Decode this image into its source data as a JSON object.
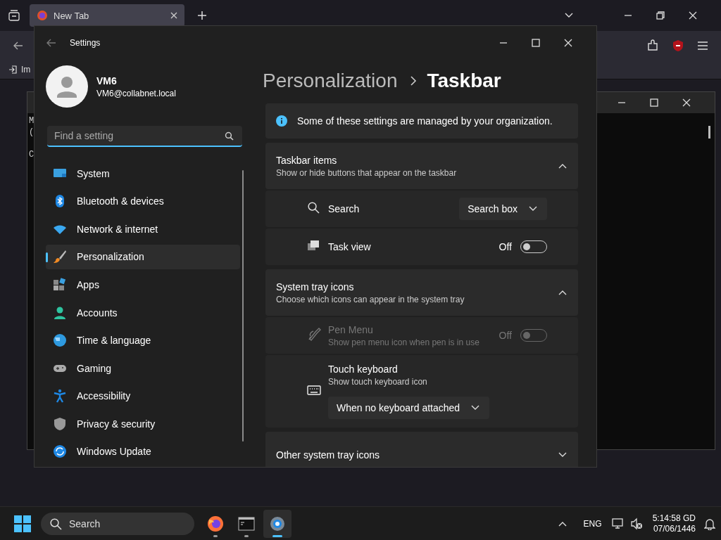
{
  "browser": {
    "tabs": [
      {
        "label": "New Tab",
        "selected": true
      }
    ],
    "bookmarks": [
      {
        "label": "Im"
      }
    ]
  },
  "terminal": {
    "lines": [
      "M",
      "(",
      "C"
    ]
  },
  "settings": {
    "title": "Settings",
    "user": {
      "name": "VM6",
      "email": "VM6@collabnet.local"
    },
    "search": {
      "placeholder": "Find a setting"
    },
    "nav": [
      {
        "label": "System",
        "selected": false
      },
      {
        "label": "Bluetooth & devices",
        "selected": false
      },
      {
        "label": "Network & internet",
        "selected": false
      },
      {
        "label": "Personalization",
        "selected": true
      },
      {
        "label": "Apps",
        "selected": false
      },
      {
        "label": "Accounts",
        "selected": false
      },
      {
        "label": "Time & language",
        "selected": false
      },
      {
        "label": "Gaming",
        "selected": false
      },
      {
        "label": "Accessibility",
        "selected": false
      },
      {
        "label": "Privacy & security",
        "selected": false
      },
      {
        "label": "Windows Update",
        "selected": false
      }
    ],
    "breadcrumb": [
      "Personalization",
      "Taskbar"
    ],
    "notice": "Some of these settings are managed by your organization.",
    "sections": [
      {
        "title": "Taskbar items",
        "subtitle": "Show or hide buttons that appear on the taskbar",
        "expanded": true,
        "rows": [
          {
            "kind": "dropdown",
            "label": "Search",
            "value": "Search box"
          },
          {
            "kind": "toggle",
            "label": "Task view",
            "state_text": "Off",
            "on": false,
            "disabled": false
          }
        ]
      },
      {
        "title": "System tray icons",
        "subtitle": "Choose which icons can appear in the system tray",
        "expanded": true,
        "rows": [
          {
            "kind": "toggle",
            "label": "Pen Menu",
            "description": "Show pen menu icon when pen is in use",
            "state_text": "Off",
            "on": false,
            "disabled": true
          },
          {
            "kind": "dropdown-below",
            "label": "Touch keyboard",
            "description": "Show touch keyboard icon",
            "value": "When no keyboard attached"
          }
        ]
      },
      {
        "title": "Other system tray icons",
        "expanded": false
      }
    ]
  },
  "taskbar": {
    "search": {
      "placeholder": "Search"
    },
    "apps": [
      {
        "selected": false
      },
      {
        "selected": false
      },
      {
        "selected": true
      }
    ],
    "language": "ENG",
    "time": "5:14:58 GD",
    "date": "07/06/1446"
  }
}
